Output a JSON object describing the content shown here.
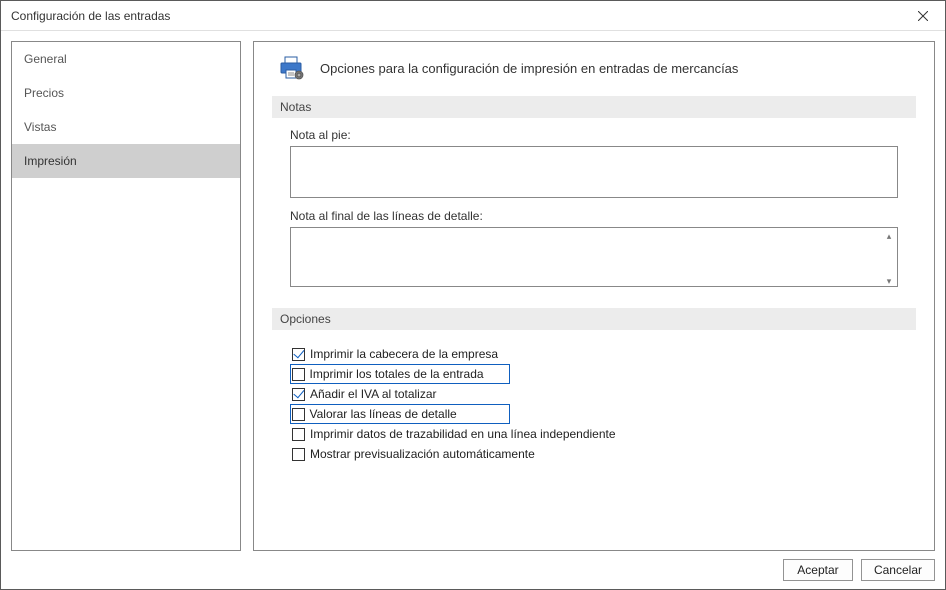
{
  "window": {
    "title": "Configuración de las entradas"
  },
  "sidebar": {
    "items": [
      {
        "label": "General",
        "selected": false
      },
      {
        "label": "Precios",
        "selected": false
      },
      {
        "label": "Vistas",
        "selected": false
      },
      {
        "label": "Impresión",
        "selected": true
      }
    ]
  },
  "main": {
    "icon": "printer-icon",
    "title": "Opciones para la configuración de impresión en entradas de mercancías",
    "sections": {
      "notas": {
        "header": "Notas",
        "footer_note_label": "Nota al pie:",
        "footer_note_value": "",
        "detail_end_note_label": "Nota al final de las líneas de detalle:",
        "detail_end_note_value": ""
      },
      "opciones": {
        "header": "Opciones",
        "items": [
          {
            "label": "Imprimir la cabecera de la empresa",
            "checked": true,
            "highlighted": false
          },
          {
            "label": "Imprimir los totales de la entrada",
            "checked": false,
            "highlighted": true
          },
          {
            "label": "Añadir el IVA al totalizar",
            "checked": true,
            "highlighted": false
          },
          {
            "label": "Valorar las líneas de detalle",
            "checked": false,
            "highlighted": true
          },
          {
            "label": "Imprimir datos de trazabilidad en una línea independiente",
            "checked": false,
            "highlighted": false
          },
          {
            "label": "Mostrar previsualización automáticamente",
            "checked": false,
            "highlighted": false
          }
        ]
      }
    }
  },
  "footer": {
    "accept": "Aceptar",
    "cancel": "Cancelar"
  }
}
